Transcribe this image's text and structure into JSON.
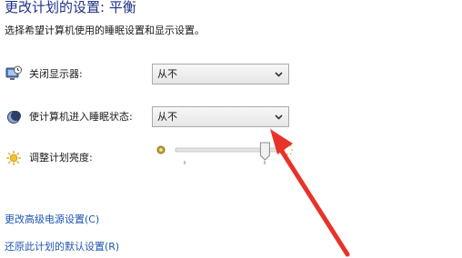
{
  "header": {
    "title": "更改计划的设置: 平衡",
    "subtitle": "选择希望计算机使用的睡眠设置和显示设置。"
  },
  "settings": {
    "display_off": {
      "label": "关闭显示器:",
      "value": "从不",
      "icon": "monitor-clock-icon"
    },
    "sleep": {
      "label": "使计算机进入睡眠状态:",
      "value": "从不",
      "icon": "moon-sleep-icon"
    },
    "brightness": {
      "label": "调整计划亮度:",
      "icon": "sun-icon",
      "level": 0.82
    }
  },
  "links": {
    "advanced": "更改高级电源设置(C)",
    "restore": "还原此计划的默认设置(R)"
  },
  "colors": {
    "title": "#1e3287",
    "link": "#1f55b2",
    "annotation_arrow": "#e8332a"
  }
}
